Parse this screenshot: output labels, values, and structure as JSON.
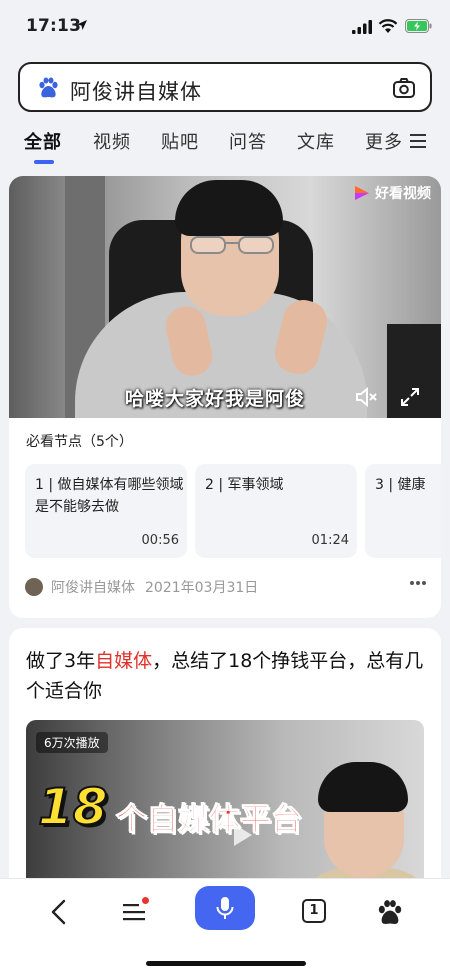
{
  "status_bar": {
    "time": "17:13"
  },
  "search": {
    "query": "阿俊讲自媒体"
  },
  "tabs": [
    {
      "label": "全部"
    },
    {
      "label": "视频"
    },
    {
      "label": "贴吧"
    },
    {
      "label": "问答"
    },
    {
      "label": "文库"
    },
    {
      "label": "更多"
    }
  ],
  "video_card": {
    "brand": "好看视频",
    "caption": "哈喽大家好我是阿俊",
    "key_points_title": "必看节点（5个）",
    "chapters": [
      {
        "index": "1",
        "title": "做自媒体有哪些领域是不能够去做",
        "duration": "00:56"
      },
      {
        "index": "2",
        "title": "军事领域",
        "duration": "01:24"
      },
      {
        "index": "3",
        "title": "健康",
        "duration": ""
      }
    ],
    "author": "阿俊讲自媒体",
    "date": "2021年03月31日"
  },
  "result_card": {
    "title_before": "做了3年",
    "title_highlight": "自媒体",
    "title_after": "，总结了18个挣钱平台，总有几个适合你",
    "views": "6万次播放",
    "thumb_big": "18",
    "thumb_text": "个自媒体平台"
  },
  "bottom_nav": {
    "tab_count": "1"
  },
  "colors": {
    "accent": "#3c64f5",
    "highlight": "#e0322c",
    "voice": "#4566f0"
  }
}
